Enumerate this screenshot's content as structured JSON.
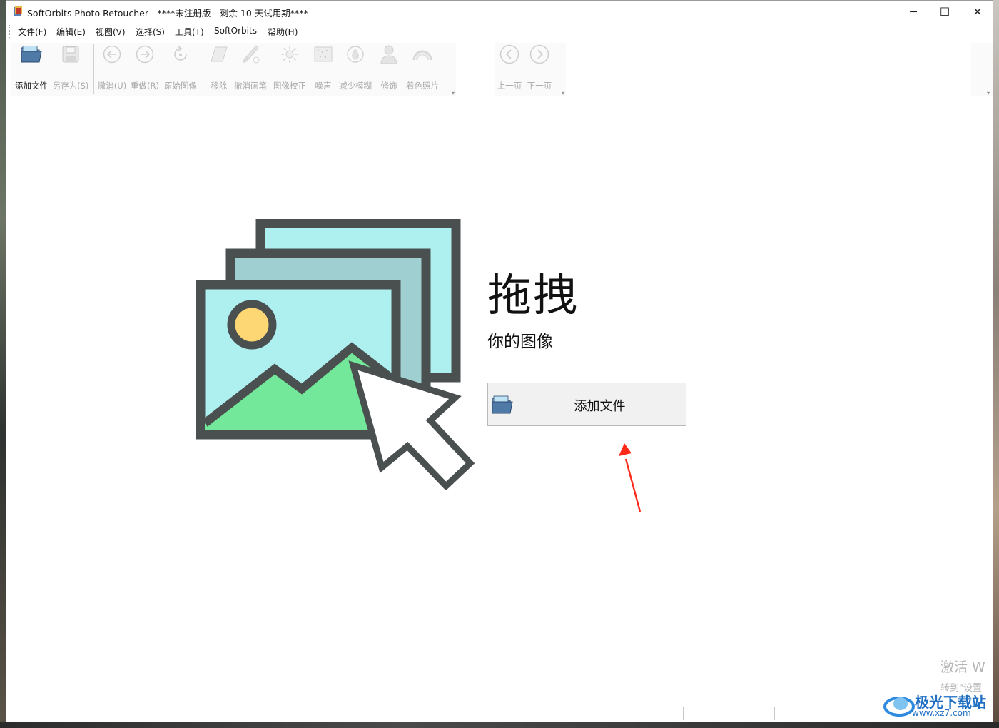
{
  "window": {
    "title": "SoftOrbits Photo Retoucher - ****未注册版 - 剩余 10 天试用期****",
    "minimize_glyph": "─",
    "maximize_glyph": "☐",
    "close_glyph": "✕"
  },
  "menu": [
    "文件(F)",
    "编辑(E)",
    "视图(V)",
    "选择(S)",
    "工具(T)",
    "SoftOrbits",
    "帮助(H)"
  ],
  "toolbar": {
    "add_file": "添加文件",
    "save_as": "另存为(S)",
    "undo": "撤消(U)",
    "redo": "重做(R)",
    "original": "原始图像",
    "remove": "移除",
    "undo_brush": "撤消画笔",
    "correct": "图像校正",
    "noise": "噪声",
    "blur": "减少模糊",
    "retouch": "修饰",
    "colorize": "着色照片",
    "prev_page": "上一页",
    "next_page": "下一页"
  },
  "main": {
    "drag_title": "拖拽",
    "drag_subtitle": "你的图像",
    "add_button": "添加文件"
  },
  "overlay": {
    "activate_line1": "激活 W",
    "activate_line2": "转到\"设置",
    "watermark_name": "极光下载站",
    "watermark_url": "www.xz7.com"
  },
  "colors": {
    "illustration_outline": "#4a4f4f",
    "photo_front": "#aeeff0",
    "photo_middle": "#9fcfd0",
    "sun": "#fdd774",
    "mountain": "#74e89a",
    "annotation_arrow": "#ff2a1a"
  }
}
